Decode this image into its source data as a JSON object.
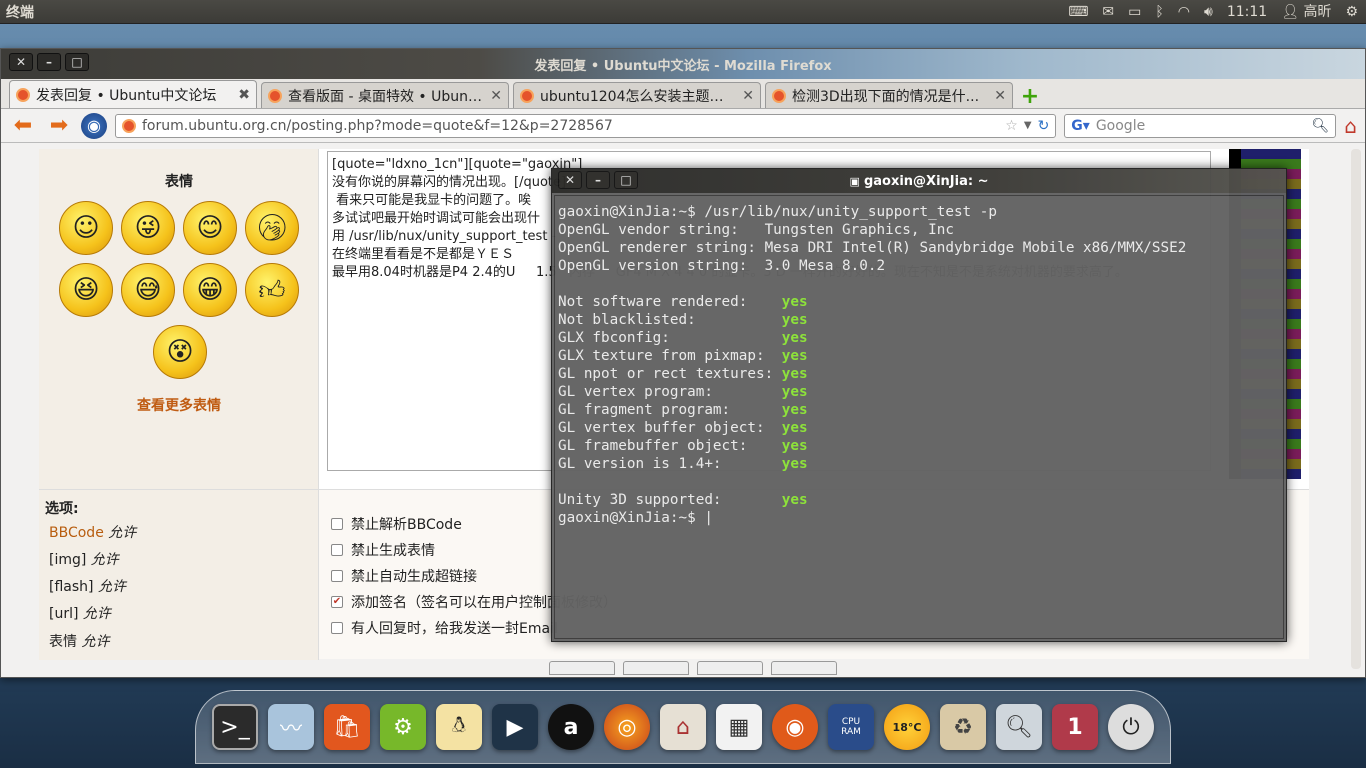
{
  "top_panel": {
    "app_title": "终端",
    "clock": "11:11",
    "user": "高昕"
  },
  "firefox": {
    "window_title": "发表回复 • Ubuntu中文论坛 - Mozilla Firefox",
    "tabs": [
      {
        "label": "发表回复 • Ubuntu中文论坛"
      },
      {
        "label": "查看版面 - 桌面特效 • Ubunt..."
      },
      {
        "label": "ubuntu1204怎么安装主题呢..."
      },
      {
        "label": "检测3D出现下面的情况是什..."
      }
    ],
    "url": "forum.ubuntu.org.cn/posting.php?mode=quote&f=12&p=2728567",
    "search_placeholder": "Google"
  },
  "page": {
    "smiley_title": "表情",
    "more_smileys": "查看更多表情",
    "editor_lines": [
      "[quote=\"ldxno_1cn\"][quote=\"gaoxin\"]",
      "",
      "没有你说的屏幕闪的情况出现。[/quote]",
      " 看来只可能是我显卡的问题了。唉",
      "",
      "多试试吧最开始时调试可能会出现什",
      "用 /usr/lib/nux/unity_support_test -",
      "在终端里看看是不是都是ＹＥＳ",
      "",
      "最早用8.04时机器是P4 2.4的U     1.5   内存     GF4 M X 4 4 0 的显卡。3 D 一样开的好好的。现在不知是不是系统对机器的要求高了。"
    ],
    "options_title": "选项:",
    "options": [
      {
        "key": "BBCode",
        "value": "允许"
      },
      {
        "key": "[img]",
        "value": "允许"
      },
      {
        "key": "[flash]",
        "value": "允许"
      },
      {
        "key": "[url]",
        "value": "允许"
      },
      {
        "key": "表情",
        "value": "允许"
      }
    ],
    "checkboxes": [
      {
        "label": "禁止解析BBCode",
        "checked": false
      },
      {
        "label": "禁止生成表情",
        "checked": false
      },
      {
        "label": "禁止自动生成超链接",
        "checked": false
      },
      {
        "label": "添加签名（签名可以在用户控制面板修改）",
        "checked": true
      },
      {
        "label": "有人回复时，给我发送一封Email",
        "checked": false
      }
    ]
  },
  "terminal": {
    "title": "gaoxin@XinJia: ~",
    "prompt_command": "gaoxin@XinJia:~$ /usr/lib/nux/unity_support_test -p",
    "info_lines": [
      "OpenGL vendor string:   Tungsten Graphics, Inc",
      "OpenGL renderer string: Mesa DRI Intel(R) Sandybridge Mobile x86/MMX/SSE2",
      "OpenGL version string:  3.0 Mesa 8.0.2"
    ],
    "checks": [
      {
        "label": "Not software rendered:    ",
        "value": "yes"
      },
      {
        "label": "Not blacklisted:          ",
        "value": "yes"
      },
      {
        "label": "GLX fbconfig:             ",
        "value": "yes"
      },
      {
        "label": "GLX texture from pixmap:  ",
        "value": "yes"
      },
      {
        "label": "GL npot or rect textures: ",
        "value": "yes"
      },
      {
        "label": "GL vertex program:        ",
        "value": "yes"
      },
      {
        "label": "GL fragment program:      ",
        "value": "yes"
      },
      {
        "label": "GL vertex buffer object:  ",
        "value": "yes"
      },
      {
        "label": "GL framebuffer object:    ",
        "value": "yes"
      },
      {
        "label": "GL version is 1.4+:       ",
        "value": "yes"
      }
    ],
    "summary_label": "Unity 3D supported:       ",
    "summary_value": "yes",
    "final_prompt": "gaoxin@XinJia:~$ "
  },
  "dock": {
    "weather_temp": "18°C",
    "workspace_badge": "1",
    "cpu_label": "CPU",
    "ram_label": "RAM"
  },
  "colors": {
    "terminal_yes": "#8ae234",
    "link_orange": "#c05c13"
  }
}
